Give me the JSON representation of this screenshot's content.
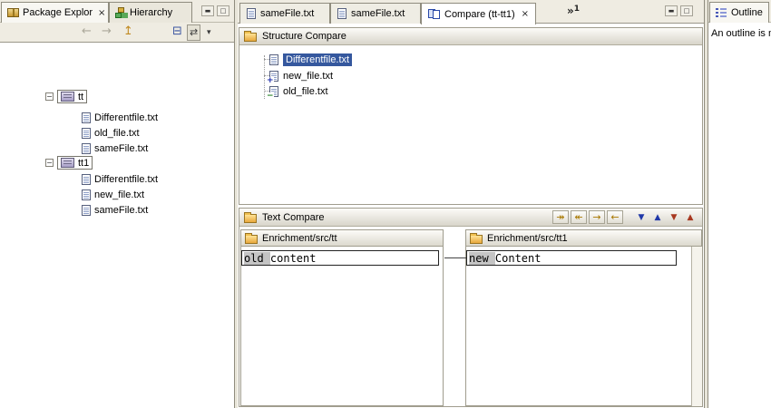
{
  "icons": {
    "close": "×",
    "minimize": "▬",
    "maximize": "□",
    "dropdown": "▾",
    "back": "←",
    "forward": "→",
    "up_level": "↥",
    "collapse_all": "⊟",
    "link_with_editor": "⇄",
    "chevron": "»",
    "copy_all_left_to_right": "↠",
    "copy_all_right_to_left": "↞",
    "copy_left_to_right": "→",
    "copy_right_to_left": "←",
    "next_difference": "▼",
    "previous_difference": "▲",
    "next_change": "▼",
    "previous_change": "▲",
    "collapse": "−"
  },
  "left_view": {
    "tabs": [
      {
        "label": "Package Explor"
      },
      {
        "label": "Hierarchy"
      }
    ],
    "tree": {
      "node1": {
        "label": "tt",
        "children": [
          "Differentfile.txt",
          "old_file.txt",
          "sameFile.txt"
        ]
      },
      "node2": {
        "label": "tt1",
        "children": [
          "Differentfile.txt",
          "new_file.txt",
          "sameFile.txt"
        ]
      }
    }
  },
  "editor_area": {
    "tabs": [
      {
        "label": "sameFile.txt"
      },
      {
        "label": "sameFile.txt"
      },
      {
        "label": "Compare (tt-tt1)"
      }
    ],
    "hidden_tabs_count": "1",
    "structure_compare": {
      "title": "Structure Compare",
      "items": [
        {
          "label": "Differentfile.txt",
          "state": "selected"
        },
        {
          "label": "new_file.txt",
          "state": "added"
        },
        {
          "label": "old_file.txt",
          "state": "removed"
        }
      ]
    },
    "text_compare": {
      "title": "Text Compare",
      "left_pane": {
        "path": "Enrichment/src/tt",
        "changed_text": "old ",
        "unchanged_text": "content"
      },
      "right_pane": {
        "path": "Enrichment/src/tt1",
        "changed_text": "new ",
        "unchanged_text": "Content"
      }
    }
  },
  "outline_view": {
    "tab_label": "Outline",
    "message": "An outline is not available."
  },
  "colors": {
    "selection_blue": "#35589E",
    "chrome": "#EFECE2",
    "border": "#A09D8E",
    "diff_highlight": "#C4C4C4",
    "folder_yellow": "#E8A83C"
  }
}
